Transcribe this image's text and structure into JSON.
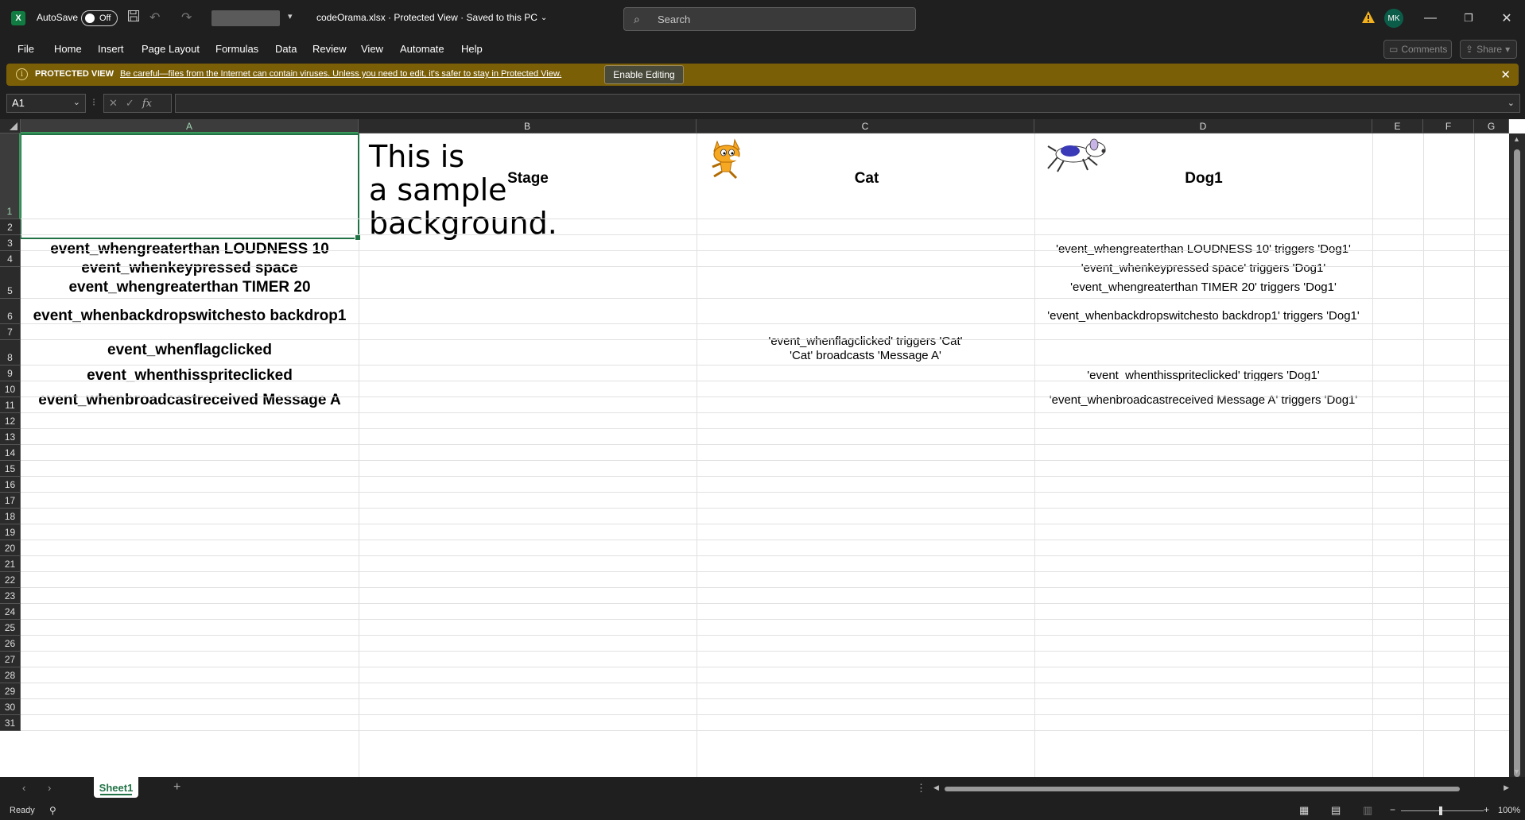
{
  "titlebar": {
    "autosave_label": "AutoSave",
    "autosave_state": "Off",
    "doc_title": "codeOrama.xlsx  ·  Protected View  ·  Saved to this PC",
    "search_placeholder": "Search",
    "user_initials": "MK"
  },
  "menu": {
    "items": [
      "File",
      "Home",
      "Insert",
      "Page Layout",
      "Formulas",
      "Data",
      "Review",
      "View",
      "Automate",
      "Help"
    ],
    "comments": "Comments",
    "share": "Share"
  },
  "protected_view": {
    "title": "PROTECTED VIEW",
    "message": "Be careful—files from the Internet can contain viruses. Unless you need to edit, it's safer to stay in Protected View.",
    "enable_button": "Enable Editing"
  },
  "formula_bar": {
    "name_box": "A1",
    "formula": ""
  },
  "columns": [
    "A",
    "B",
    "C",
    "D",
    "E",
    "F",
    "G"
  ],
  "rows": [
    "1",
    "2",
    "3",
    "4",
    "5",
    "6",
    "7",
    "8",
    "9",
    "10",
    "11",
    "12",
    "13",
    "14",
    "15",
    "16",
    "17",
    "18",
    "19",
    "20",
    "21",
    "22",
    "23",
    "24",
    "25",
    "26",
    "27",
    "28",
    "29",
    "30",
    "31"
  ],
  "cells": {
    "b1_image_text": [
      "This is",
      "a sample",
      "background."
    ],
    "b1": "Stage",
    "c1": "Cat",
    "d1": "Dog1",
    "a2": "event_whengreaterthan LOUDNESS 10",
    "a3": "event_whenkeypressed space",
    "a4": "event_whengreaterthan TIMER 20",
    "a5": "event_whenbackdropswitchesto backdrop1",
    "a6": "event_whenflagclicked",
    "a7": "event_whenthisspriteclicked",
    "a8": "event_whenbroadcastreceived Message A",
    "d2": "'event_whengreaterthan LOUDNESS 10' triggers 'Dog1'",
    "d3": "'event_whenkeypressed space' triggers 'Dog1'",
    "d4": "'event_whengreaterthan TIMER 20' triggers 'Dog1'",
    "d5": "'event_whenbackdropswitchesto backdrop1' triggers 'Dog1'",
    "c6_line1": "'event_whenflagclicked' triggers 'Cat'",
    "c6_line2": "'Cat' broadcasts 'Message A'",
    "d7": "'event_whenthisspriteclicked' triggers 'Dog1'",
    "d8": "'event_whenbroadcastreceived Message A' triggers 'Dog1'"
  },
  "sheets": [
    "Sheet1"
  ],
  "status": {
    "ready": "Ready",
    "zoom": "100%"
  }
}
